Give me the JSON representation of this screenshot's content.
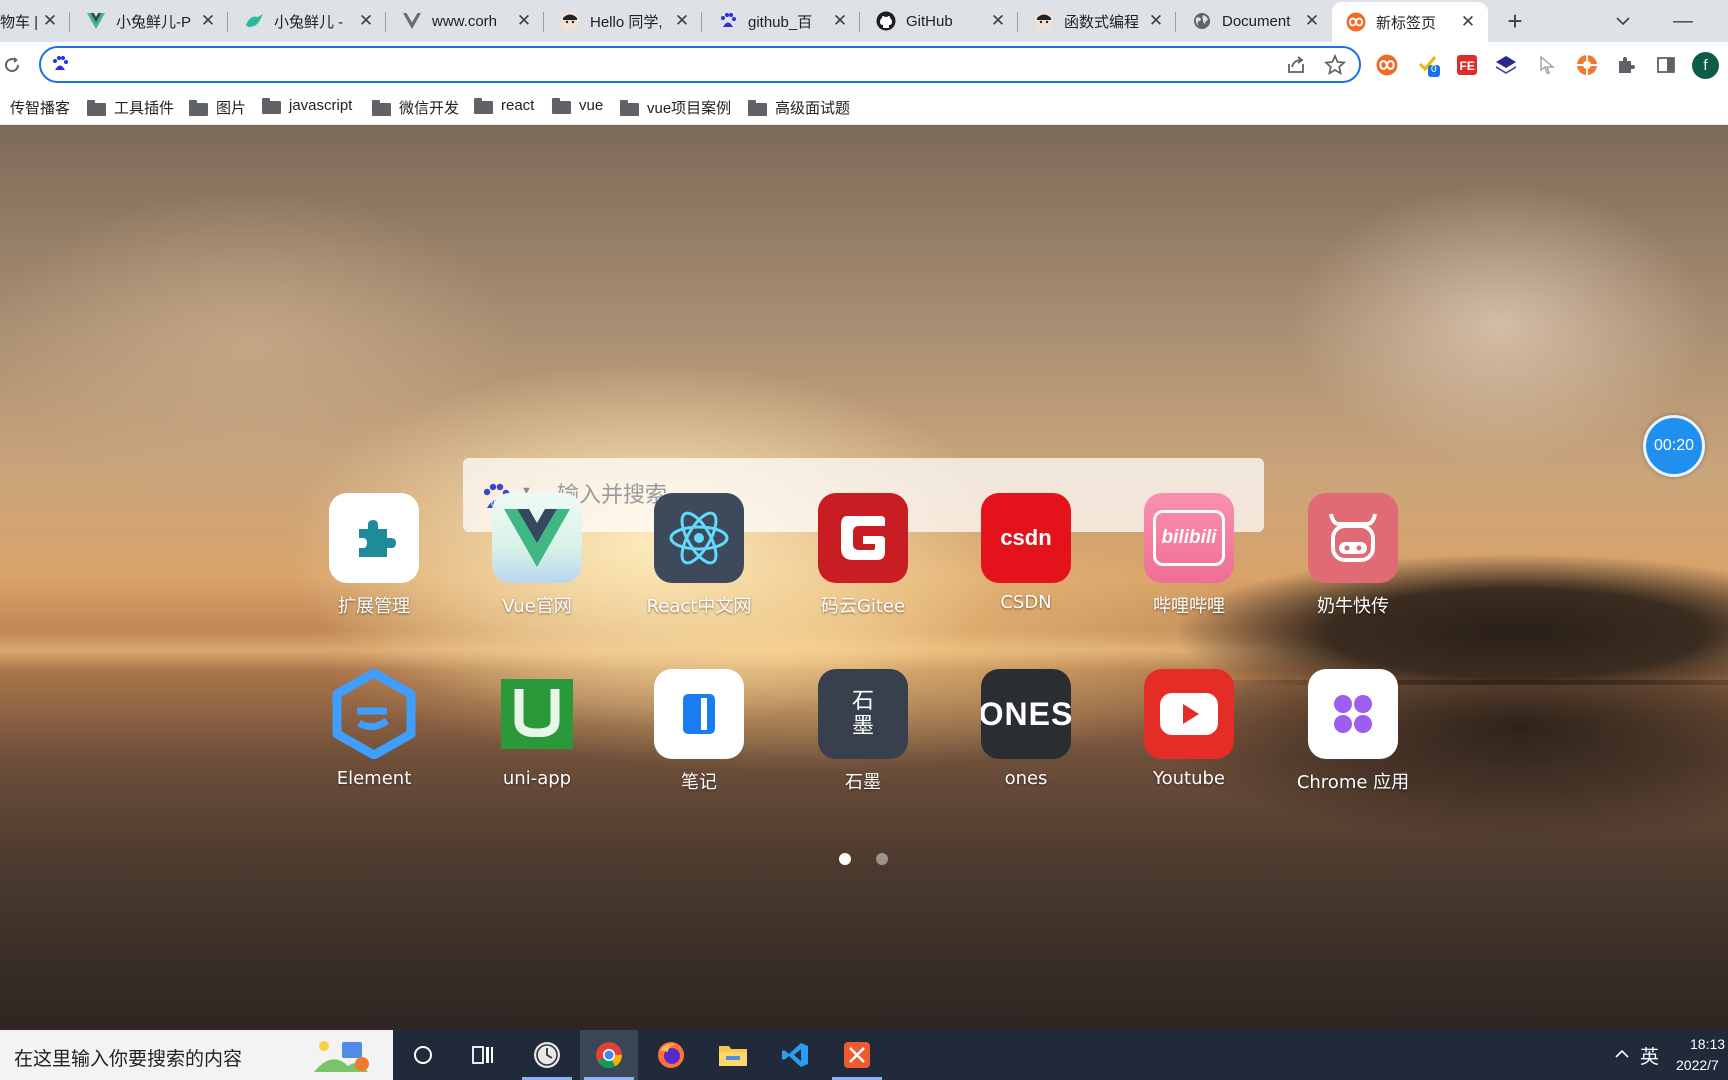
{
  "tabs": [
    {
      "title": "物车 |",
      "icon": "page-icon"
    },
    {
      "title": "小兔鲜儿-P",
      "icon": "vue-logo-icon"
    },
    {
      "title": "小兔鲜儿 -",
      "icon": "rabbit-icon"
    },
    {
      "title": "www.corh",
      "icon": "vue-logo-icon"
    },
    {
      "title": "Hello 同学,",
      "icon": "avatar-icon"
    },
    {
      "title": "github_百",
      "icon": "baidu-paw-icon"
    },
    {
      "title": "GitHub",
      "icon": "github-icon"
    },
    {
      "title": "函数式编程",
      "icon": "avatar-icon"
    },
    {
      "title": "Document",
      "icon": "globe-icon"
    },
    {
      "title": "新标签页",
      "icon": "infinity-icon",
      "active": true
    }
  ],
  "toolbar": {
    "omnibox_value": "",
    "extensions": [
      "infinity-icon",
      "check-badge-icon",
      "fe-icon",
      "layers-icon",
      "cursor-icon",
      "orange-ext-icon",
      "puzzle-icon",
      "sidepanel-icon"
    ],
    "badge_count": "0",
    "profile_initial": "f"
  },
  "bookmarks": [
    {
      "label": "传智播客",
      "folder": false
    },
    {
      "label": "工具插件",
      "folder": true
    },
    {
      "label": "图片",
      "folder": true
    },
    {
      "label": "javascript",
      "folder": true
    },
    {
      "label": "微信开发",
      "folder": true
    },
    {
      "label": "react",
      "folder": true
    },
    {
      "label": "vue",
      "folder": true
    },
    {
      "label": "vue项目案例",
      "folder": true
    },
    {
      "label": "高级面试题",
      "folder": true
    }
  ],
  "search": {
    "placeholder": "输入并搜索...",
    "engine": "baidu"
  },
  "apps": [
    {
      "label": "扩展管理",
      "icon": "puzzle-icon",
      "bg": "#ffffff"
    },
    {
      "label": "Vue官网",
      "icon": "vue-logo-icon",
      "bg": "#e9f7f1"
    },
    {
      "label": "React中文网",
      "icon": "react-atom-icon",
      "bg": "#3d4a5c"
    },
    {
      "label": "码云Gitee",
      "icon": "gitee-icon",
      "bg": "#c71d23"
    },
    {
      "label": "CSDN",
      "icon": "csdn-icon",
      "bg": "#e4131b",
      "text": "csdn"
    },
    {
      "label": "哔哩哔哩",
      "icon": "bilibili-icon",
      "bg": "#f07fa0",
      "text": "bilibili"
    },
    {
      "label": "奶牛快传",
      "icon": "cow-icon",
      "bg": "#e06b74"
    },
    {
      "label": "Element",
      "icon": "element-hexagon-icon",
      "bg": "transparent"
    },
    {
      "label": "uni-app",
      "icon": "uniapp-icon",
      "bg": "transparent"
    },
    {
      "label": "笔记",
      "icon": "notes-icon",
      "bg": "#ffffff"
    },
    {
      "label": "石墨",
      "icon": "shimo-icon",
      "bg": "#37404c",
      "text": "石\n墨"
    },
    {
      "label": "ones",
      "icon": "ones-icon",
      "bg": "#2a2e33",
      "text": "ONES"
    },
    {
      "label": "Youtube",
      "icon": "youtube-play-icon",
      "bg": "#e52d27"
    },
    {
      "label": "Chrome 应用",
      "icon": "apps-grid-icon",
      "bg": "#ffffff"
    }
  ],
  "pager": {
    "pages": 2,
    "current": 1
  },
  "timer": {
    "text": "00:20"
  },
  "taskbar": {
    "search_placeholder": "在这里输入你要搜索的内容",
    "apps": [
      "cortana-icon",
      "task-view-icon",
      "clock-app-icon",
      "chrome-icon",
      "firefox-icon",
      "file-explorer-icon",
      "vscode-icon",
      "xmind-icon"
    ],
    "ime": "英",
    "time": "18:13",
    "date": "2022/7"
  },
  "colors": {
    "accent": "#1a73e8",
    "tabstrip": "#dee1e6",
    "taskbar": "#202a3a"
  }
}
